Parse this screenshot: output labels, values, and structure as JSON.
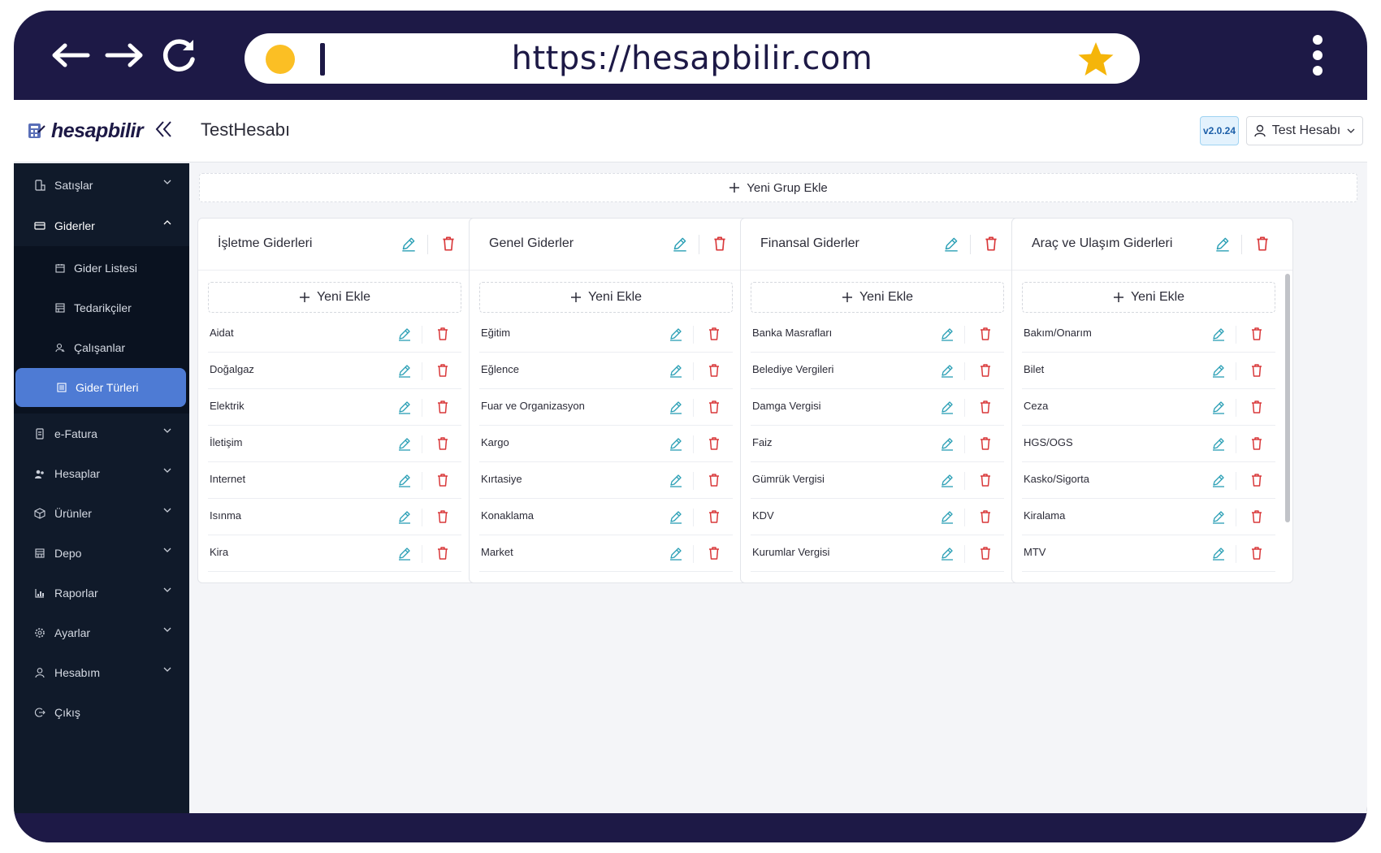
{
  "browser": {
    "url": "https://hesapbilir.com"
  },
  "header": {
    "logo_text": "hesapbilir",
    "page_title": "TestHesabı",
    "version": "v2.0.24",
    "user_label": "Test Hesabı"
  },
  "sidebar": {
    "items": [
      {
        "label": "Satışlar",
        "icon": "phone-cart-icon"
      },
      {
        "label": "Giderler",
        "icon": "expense-card-icon"
      },
      {
        "label": "e-Fatura",
        "icon": "invoice-icon"
      },
      {
        "label": "Hesaplar",
        "icon": "users-icon"
      },
      {
        "label": "Ürünler",
        "icon": "box-icon"
      },
      {
        "label": "Depo",
        "icon": "warehouse-icon"
      },
      {
        "label": "Raporlar",
        "icon": "chart-icon"
      },
      {
        "label": "Ayarlar",
        "icon": "gear-icon"
      },
      {
        "label": "Hesabım",
        "icon": "user-icon"
      },
      {
        "label": "Çıkış",
        "icon": "logout-icon"
      }
    ],
    "sub_items": [
      {
        "label": "Gider Listesi",
        "icon": "calendar-icon"
      },
      {
        "label": "Tedarikçiler",
        "icon": "building-icon"
      },
      {
        "label": "Çalışanlar",
        "icon": "employee-icon"
      },
      {
        "label": "Gider Türleri",
        "icon": "list-icon"
      }
    ]
  },
  "main": {
    "add_group_label": "Yeni Grup Ekle",
    "add_item_label": "Yeni Ekle",
    "groups": [
      {
        "title": "İşletme Giderleri",
        "items": [
          "Aidat",
          "Doğalgaz",
          "Elektrik",
          "İletişim",
          "Internet",
          "Isınma",
          "Kira"
        ]
      },
      {
        "title": "Genel Giderler",
        "items": [
          "Eğitim",
          "Eğlence",
          "Fuar ve Organizasyon",
          "Kargo",
          "Kırtasiye",
          "Konaklama",
          "Market"
        ]
      },
      {
        "title": "Finansal Giderler",
        "items": [
          "Banka Masrafları",
          "Belediye Vergileri",
          "Damga Vergisi",
          "Faiz",
          "Gümrük Vergisi",
          "KDV",
          "Kurumlar Vergisi"
        ]
      },
      {
        "title": "Araç ve Ulaşım Giderleri",
        "items": [
          "Bakım/Onarım",
          "Bilet",
          "Ceza",
          "HGS/OGS",
          "Kasko/Sigorta",
          "Kiralama",
          "MTV"
        ]
      }
    ]
  },
  "colors": {
    "frame": "#1d1946",
    "sidebar": "#101a2a",
    "sidebar_active": "#4e7bd4",
    "edit_icon": "#2a9fb5",
    "delete_icon": "#d9383a",
    "url_dot": "#fbbf24",
    "star": "#f5b50a"
  }
}
